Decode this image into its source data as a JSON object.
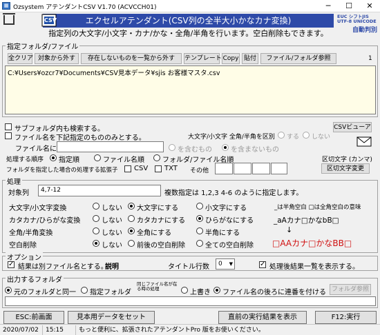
{
  "window": {
    "title": "Ozsystem アテンダントCSV V1.70 (ACVCCH01)",
    "minimize": "─",
    "maximize": "☐",
    "close": "✕"
  },
  "header": {
    "logo_text": "CSV",
    "banner": "エクセルアテンダント(CSV列の全半大小かなカナ変換)",
    "subtitle": "指定列の大文字/小文字・カナ/かな・全角/半角を行います。空白削除もできます。",
    "enc_lines": [
      "EUC  シフトJIS",
      "UTF-8  UNICODE"
    ],
    "enc_label": "自動判別"
  },
  "files_section": {
    "label": "指定フォルダ/ファイル",
    "toolbar": [
      "全クリア",
      "対象から外す",
      "存在しないものを一覧から外す",
      "テンプレート",
      "Copy",
      "貼付",
      "ファイル/フォルダ参照"
    ],
    "count": "1",
    "file_path": "C:¥Users¥ozcr7¥Documents¥CSV見本データ¥sjis お客様マスタ.csv"
  },
  "options_top": {
    "subfolder": "サブフォルダ内も検索する。",
    "filename_only": "ファイル名を下記指定のもののみとする。",
    "case_label": "大文字/小文字 全角/半角を区別",
    "case_yes": "する",
    "case_no": "しない",
    "csv_viewer": "CSVビューア",
    "filename_in": "ファイル名に",
    "filename_value": "",
    "contains": "を含むもの",
    "not_contains": "を含まないもの",
    "order_label": "処理する順序",
    "order_opts": [
      "指定順",
      "ファイル名順",
      "フォルダ/ファイル名順"
    ],
    "delim_label": "区切文字 (カンマ)",
    "ext_label": "フォルダを指定した場合の処理する拡張子",
    "ext_csv": "CSV",
    "ext_txt": "TXT",
    "ext_other": "その他",
    "delim_change": "区切文字変更"
  },
  "process": {
    "label": "処理",
    "target_label": "対象列",
    "target_value": "4,7-12",
    "target_hint": "複数指定は  1,2,3   4-6 のように指定します。",
    "rows": [
      {
        "label": "大文字/小文字変換",
        "opts": [
          "しない",
          "大文字にする",
          "小文字にする"
        ]
      },
      {
        "label": "カタカナ/ひらがな変換",
        "opts": [
          "しない",
          "カタカナにする",
          "ひらがなにする"
        ]
      },
      {
        "label": "全角/半角変換",
        "opts": [
          "しない",
          "全角にする",
          "半角にする"
        ]
      },
      {
        "label": "空白削除",
        "opts": [
          "しない",
          "前後の空白削除",
          "全ての空白削除"
        ]
      }
    ],
    "legend": "_は半角空白 □は全角空白の意味",
    "example_before": "_aAカナ□かなbB□",
    "example_arrow": "↓",
    "example_after": "□AAカナ□かなBB□"
  },
  "option_section": {
    "label": "オプション",
    "result_file": "結果は別ファイル名とする。",
    "explain": "説明",
    "title_rows_label": "タイトル行数",
    "title_rows_value": "0",
    "show_list": "処理後結果一覧を表示する。"
  },
  "output_section": {
    "label": "出力するフォルダ",
    "same_folder": "元のフォルダと同一",
    "specified_folder": "指定フォルダ",
    "same_name_label": "同じファイル名が在る時の処理",
    "overwrite": "上書き",
    "append_seq": "ファイル名の後ろに連番を付ける",
    "folder_browse": "フォルダ参照",
    "folder_value": ""
  },
  "buttons": {
    "esc": "ESC:前画面",
    "sample": "見本用データをセット",
    "prev_result": "直前の実行結果を表示",
    "run": "F12:実行"
  },
  "status": {
    "date": "2020/07/02",
    "time": "15:15",
    "message": "もっと便利に、拡張されたアテンダントPro 版をお使いください。"
  }
}
